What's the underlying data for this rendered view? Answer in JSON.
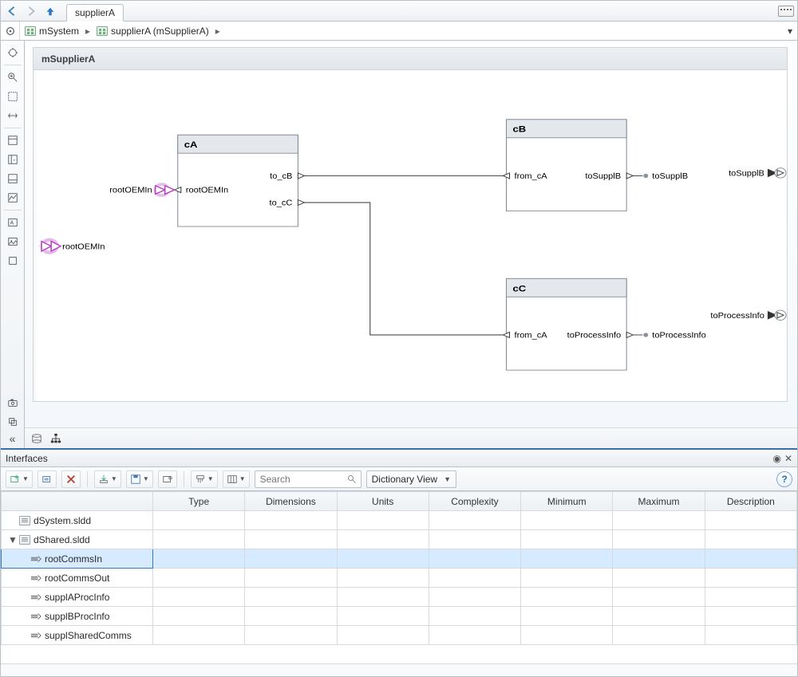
{
  "topbar": {
    "tab_label": "supplierA"
  },
  "breadcrumb": {
    "items": [
      {
        "label": "mSystem"
      },
      {
        "label": "supplierA (mSupplierA)"
      }
    ]
  },
  "canvas": {
    "title": "mSupplierA",
    "root_in_port": "rootOEMIn",
    "signals": {
      "rootOEMIn_to_cA": "rootOEMIn",
      "cB_to_out": "toSupplB",
      "cC_to_out": "toProcessInfo"
    },
    "outputs": {
      "toSupplB": "toSupplB",
      "toProcessInfo": "toProcessInfo"
    },
    "blocks": {
      "cA": {
        "title": "cA",
        "in": [
          "rootOEMIn"
        ],
        "out": [
          "to_cB",
          "to_cC"
        ]
      },
      "cB": {
        "title": "cB",
        "in": [
          "from_cA"
        ],
        "out": [
          "toSupplB"
        ]
      },
      "cC": {
        "title": "cC",
        "in": [
          "from_cA"
        ],
        "out": [
          "toProcessInfo"
        ]
      }
    }
  },
  "interfaces": {
    "panel_title": "Interfaces",
    "search_placeholder": "Search",
    "view_selector": "Dictionary View",
    "columns": [
      "Type",
      "Dimensions",
      "Units",
      "Complexity",
      "Minimum",
      "Maximum",
      "Description"
    ],
    "tree": [
      {
        "kind": "dict",
        "label": "dSystem.sldd",
        "indent": 1,
        "expanded": false
      },
      {
        "kind": "dict",
        "label": "dShared.sldd",
        "indent": 0,
        "expanded": true
      },
      {
        "kind": "iface",
        "label": "rootCommsIn",
        "indent": 2,
        "selected": true
      },
      {
        "kind": "iface",
        "label": "rootCommsOut",
        "indent": 2
      },
      {
        "kind": "iface",
        "label": "supplAProcInfo",
        "indent": 2
      },
      {
        "kind": "iface",
        "label": "supplBProcInfo",
        "indent": 2
      },
      {
        "kind": "iface",
        "label": "supplSharedComms",
        "indent": 2
      }
    ]
  }
}
